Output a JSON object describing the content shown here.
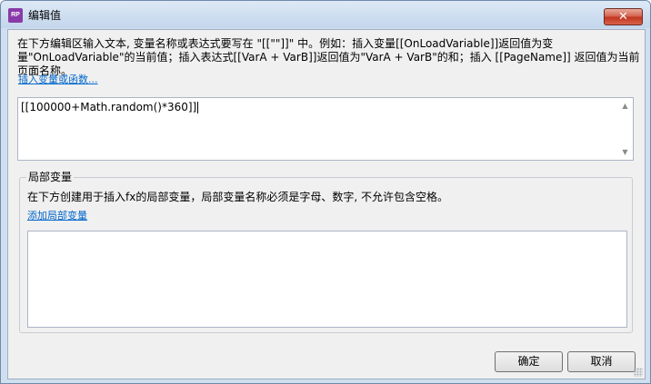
{
  "window": {
    "title": "编辑值",
    "app_icon_text": "RP",
    "close_glyph": "✕"
  },
  "description": "在下方编辑区输入文本, 变量名称或表达式要写在 \"[[\"\"]]\" 中。例如：插入变量[[OnLoadVariable]]返回值为变量\"OnLoadVariable\"的当前值；插入表达式[[VarA + VarB]]返回值为\"VarA + VarB\"的和；插入 [[PageName]] 返回值为当前页面名称。",
  "insert_link": "插入变量或函数...",
  "expression": {
    "value": "[[100000+Math.random()*360]]"
  },
  "scroll": {
    "up": "▲",
    "down": "▼"
  },
  "local_vars": {
    "legend": "局部变量",
    "description": "在下方创建用于插入fx的局部变量，局部变量名称必须是字母、数字, 不允许包含空格。",
    "add_link": "添加局部变量"
  },
  "buttons": {
    "ok": "确定",
    "cancel": "取消"
  },
  "colors": {
    "accent_link": "#0066cc",
    "close_button": "#c0341e",
    "app_icon": "#8a3aa8"
  }
}
